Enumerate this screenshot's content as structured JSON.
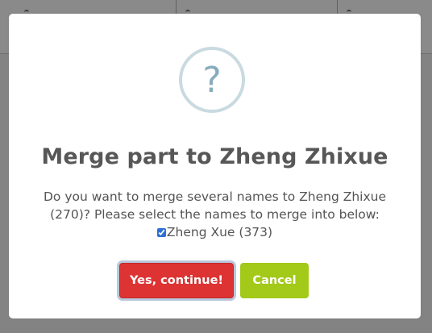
{
  "dialog": {
    "icon": "question-mark-icon",
    "icon_glyph": "?",
    "title": "Merge part to Zheng Zhixue",
    "message_line1": "Do you want to merge several names to Zheng Zhixue",
    "message_line2": "(270)? Please select the names to merge into below:",
    "merge_option_label": "Zheng Xue (373)",
    "merge_option_checked": true,
    "confirm_label": "Yes, continue!",
    "cancel_label": "Cancel"
  },
  "colors": {
    "overlay": "#838383",
    "confirm": "#dd3333",
    "cancel": "#a3c919",
    "icon_ring": "#c9dae1",
    "icon_glyph": "#87adbd",
    "title": "#575757",
    "text": "#545454"
  }
}
